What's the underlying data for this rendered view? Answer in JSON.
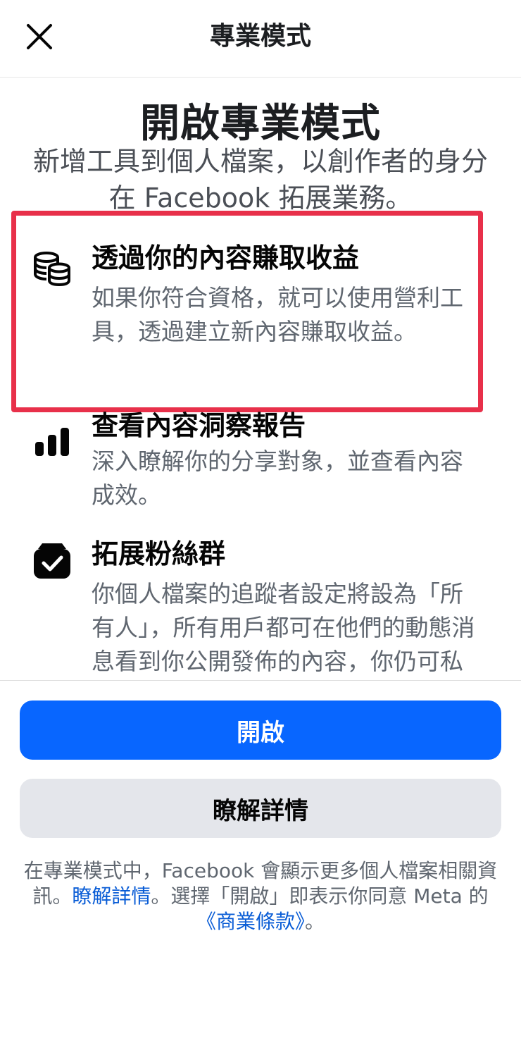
{
  "header": {
    "title": "專業模式",
    "close_icon": "close-icon"
  },
  "hero": {
    "title": "開啟專業模式",
    "subtitle": "新增工具到個人檔案，以創作者的身分在 Facebook 拓展業務。"
  },
  "features": [
    {
      "icon": "coins-stack-icon",
      "title": "透過你的內容賺取收益",
      "description": "如果你符合資格，就可以使用營利工具，透過建立新內容賺取收益。",
      "highlighted": true
    },
    {
      "icon": "bar-chart-icon",
      "title": "查看內容洞察報告",
      "description": "深入瞭解你的分享對象，並查看內容成效。"
    },
    {
      "icon": "inbox-check-icon",
      "title": "拓展粉絲群",
      "description": "你個人檔案的追蹤者設定將設為「所有人」，所有用戶都可在他們的動態消息看到你公開發佈的內容，你仍可私下與朋友分享內"
    }
  ],
  "buttons": {
    "primary": "開啟",
    "secondary": "瞭解詳情"
  },
  "footer": {
    "text_1": "在專業模式中，Facebook 會顯示更多個人檔案相關資訊。",
    "link_1": "瞭解詳情",
    "text_2": "。選擇「開啟」即表示你同意 Meta 的",
    "link_2": "《商業條款》",
    "text_3": "。"
  },
  "colors": {
    "accent": "#0866ff",
    "highlight_border": "#e8304a",
    "link": "#0a5dd6"
  }
}
